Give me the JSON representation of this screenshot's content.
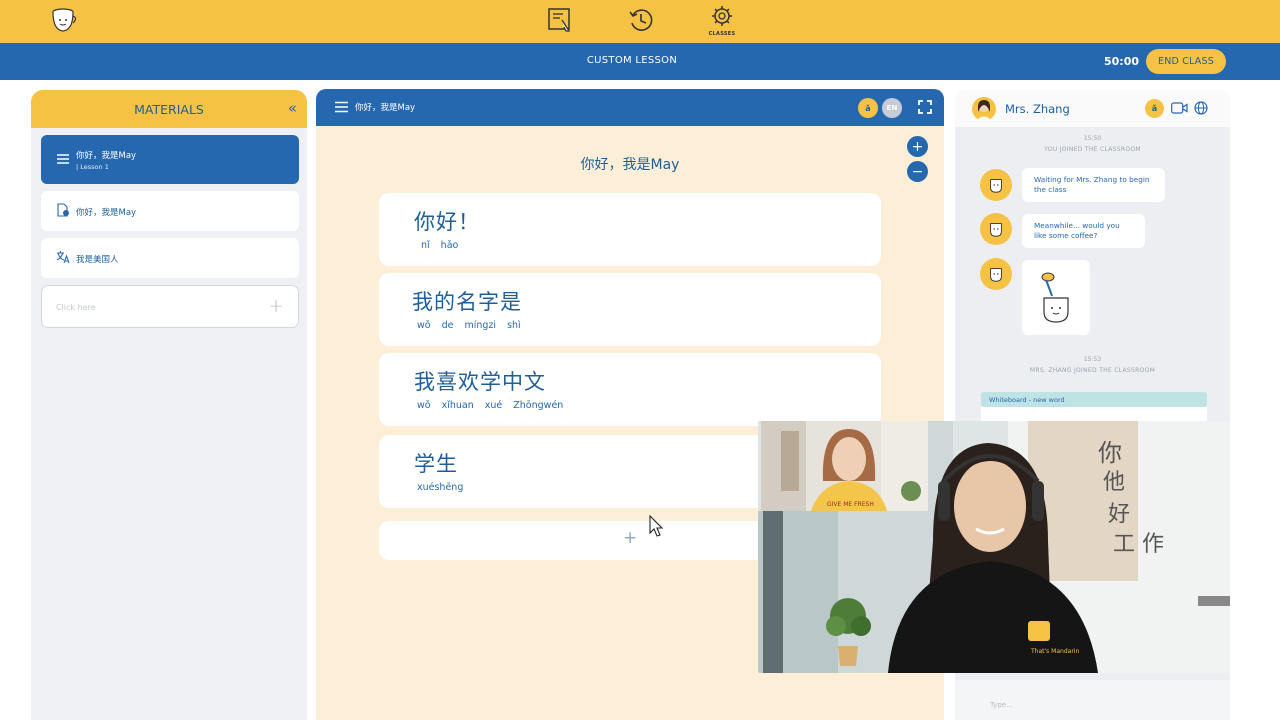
{
  "app": {
    "logo_icon": "coffee-cup-logo-icon",
    "nav": {
      "lesson_icon": "whiteboard-pointer-icon",
      "history_icon": "history-clock-icon",
      "classes_icon": "classes-gear-icon",
      "classes_label": "CLASSES"
    },
    "colors": {
      "brand_yellow": "#f6c244",
      "brand_blue": "#2568b0",
      "content_bg": "#fdefd7"
    }
  },
  "classbar": {
    "title": "CUSTOM LESSON",
    "timer": "50:00",
    "end_button": "END CLASS"
  },
  "materials": {
    "header": "MATERIALS",
    "collapse_icon": "double-chevron-left-icon",
    "items": [
      {
        "title": "你好，我是May",
        "subtitle": "| Lesson 1",
        "icon": "menu-icon",
        "selected": true
      },
      {
        "title": "你好，我是May",
        "icon": "document-settings-icon"
      },
      {
        "title": "我是美国人",
        "icon": "translate-icon"
      }
    ],
    "add_placeholder": "Click here",
    "add_plus": "+"
  },
  "lesson": {
    "header_title": "你好，我是May",
    "lang_badge": "ǎ",
    "lang_toggle": "EN",
    "content_title": "你好，我是May",
    "zoom_in": "+",
    "zoom_out": "−",
    "cards": [
      {
        "hanzi": "你好！",
        "pinyin": "nǐ hǎo"
      },
      {
        "hanzi": "我的名字是",
        "pinyin": "wǒ de míngzi shì"
      },
      {
        "hanzi": "我喜欢学中文",
        "pinyin": "wǒ xǐhuan xué Zhōngwén"
      },
      {
        "hanzi": "学生",
        "pinyin": "xuéshēng"
      }
    ],
    "add_card_plus": "+"
  },
  "chat": {
    "teacher_name": "Mrs. Zhang",
    "lang_badge": "ǎ",
    "time1": "15:50",
    "sys1": "YOU JOINED THE CLASSROOM",
    "msg1": "Waiting for Mrs. Zhang to begin the class",
    "msg2": "Meanwhile... would you like some coffee?",
    "time2": "15:53",
    "sys2": "MRS. ZHANG JOINED THE CLASSROOM",
    "whiteboard_note": "Whiteboard - new word",
    "input_placeholder": "Type..."
  },
  "video": {
    "teacher_shirt_brand": "That's Mandarin",
    "student_shirt_text": "GIVE ME FRESH",
    "whiteboard_chars": [
      "你",
      "他",
      "好",
      "工 作"
    ]
  }
}
